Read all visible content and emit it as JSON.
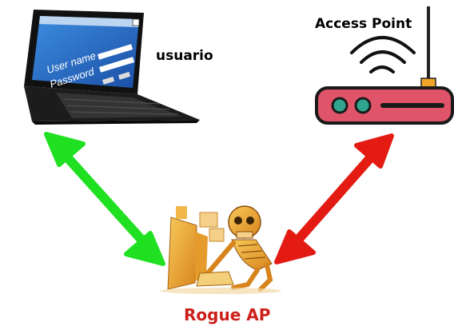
{
  "nodes": {
    "user": {
      "label": "usuario"
    },
    "access_point": {
      "label": "Access Point"
    },
    "rogue": {
      "label": "Rogue AP",
      "color": "#cc1f1a"
    }
  },
  "laptop_screen": {
    "username_label": "User name",
    "password_label": "Password"
  },
  "colors": {
    "green_arrow": "#1fe021",
    "red_arrow": "#e31b12",
    "router_body": "#e0546a",
    "router_led": "#2fa58f",
    "rogue_figure": "#e8a331"
  },
  "icons": {
    "laptop": "laptop-icon",
    "router": "router-icon",
    "wifi": "wifi-icon",
    "hacker": "hacker-skeleton-icon"
  }
}
